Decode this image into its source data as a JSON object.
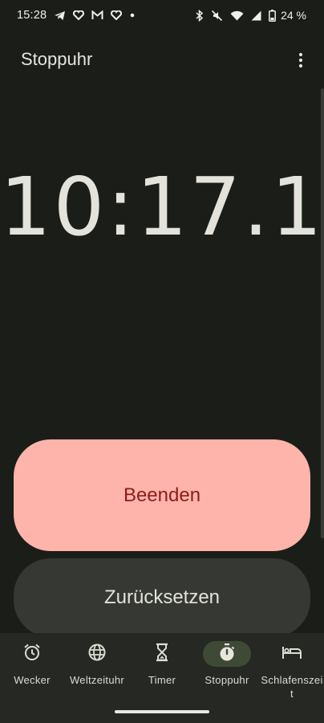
{
  "status_bar": {
    "time": "15:28",
    "battery_percent": "24 %",
    "icons": [
      "telegram-icon",
      "heart-app-icon",
      "gmail-icon",
      "heart-app-icon",
      "dot-icon",
      "bluetooth-icon",
      "mute-icon",
      "wifi-icon",
      "signal-icon",
      "battery-icon"
    ]
  },
  "app_bar": {
    "title": "Stoppuhr",
    "menu_icon": "more-vert-icon"
  },
  "stopwatch": {
    "time": "10:17.13"
  },
  "buttons": {
    "stop_label": "Beenden",
    "reset_label": "Zurücksetzen"
  },
  "bottom_nav": {
    "items": [
      {
        "label": "Wecker",
        "icon": "alarm-clock-icon",
        "active": false
      },
      {
        "label": "Weltzeituhr",
        "icon": "globe-icon",
        "active": false
      },
      {
        "label": "Timer",
        "icon": "hourglass-icon",
        "active": false
      },
      {
        "label": "Stoppuhr",
        "icon": "stopwatch-icon",
        "active": true
      },
      {
        "label": "Schlafenszeit",
        "icon": "bed-icon",
        "active": false
      }
    ]
  },
  "colors": {
    "background": "#1b1d19",
    "stop_button": "#ffb4ab",
    "stop_text": "#8c1d18",
    "reset_button": "#363833",
    "nav_background": "#262823",
    "nav_active_pill": "#3e4a36"
  }
}
